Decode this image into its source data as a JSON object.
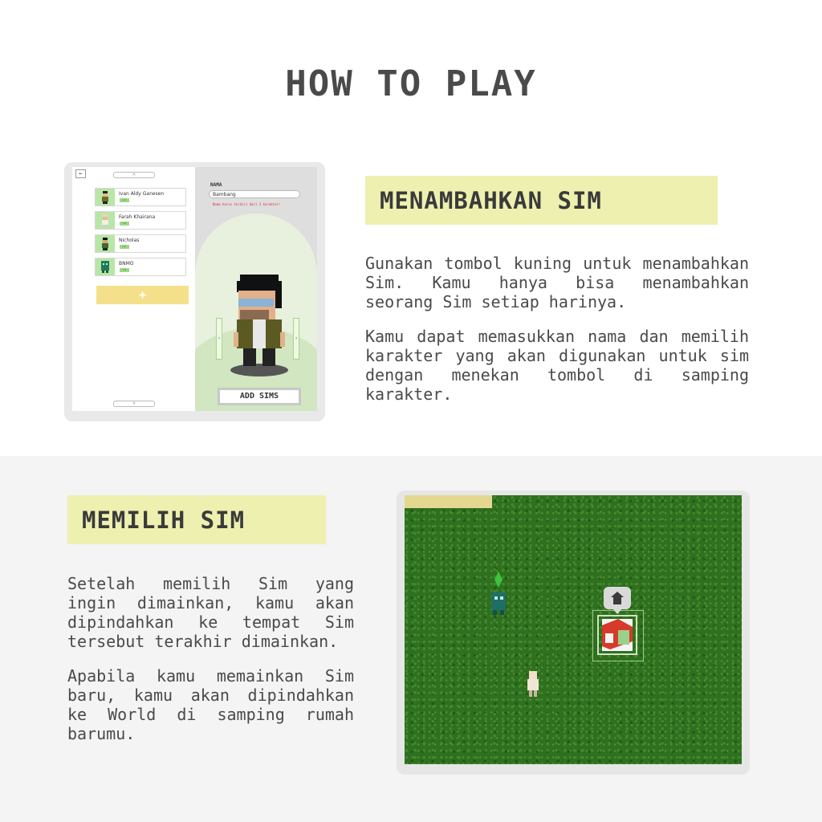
{
  "title": "HOW TO PLAY",
  "section1": {
    "heading": "MENAMBAHKAN SIM",
    "paragraph1": "Gunakan tombol kuning untuk menambahkan Sim. Kamu hanya bisa menambahkan seorang Sim setiap harinya.",
    "paragraph2": "Kamu dapat memasukkan nama dan memilih karakter yang akan digunakan untuk sim dengan menekan tombol di samping karakter.",
    "screenshot": {
      "back_icon": "arrow-left-icon",
      "up_glyph": "˄",
      "down_glyph": "˅",
      "sims": [
        {
          "name": "Ivan Aldy Ganesen",
          "tag": "lvl"
        },
        {
          "name": "Farah Khairana",
          "tag": "lvl"
        },
        {
          "name": "Nicholas",
          "tag": "lvl"
        },
        {
          "name": "BNMO",
          "tag": "lvl"
        }
      ],
      "add_glyph": "+",
      "name_label": "NAMA",
      "name_value": "Bambang",
      "name_hint": "Nama harus terdiri dari 3 karakter!",
      "prev_glyph": "‹",
      "next_glyph": "›",
      "add_sims_label": "ADD SIMS",
      "accent_yellow": "#f4e08b",
      "accent_green": "#b8e6a6"
    }
  },
  "section2": {
    "heading": "MEMILIH SIM",
    "paragraph1": "Setelah memilih Sim yang ingin dimainkan, kamu akan dipindahkan ke tempat Sim tersebut terakhir dimainkan.",
    "paragraph2": "Apabila kamu memainkan Sim baru, kamu akan dipindahkan ke World di samping rumah barumu.",
    "screenshot": {
      "home_icon": "home-icon",
      "grass_color": "#2f6f1f",
      "sand_color": "#e4d890"
    }
  },
  "colors": {
    "heading_bg": "#eef0b0",
    "bottom_bg": "#f4f4f4",
    "text": "#4a4a4a"
  }
}
